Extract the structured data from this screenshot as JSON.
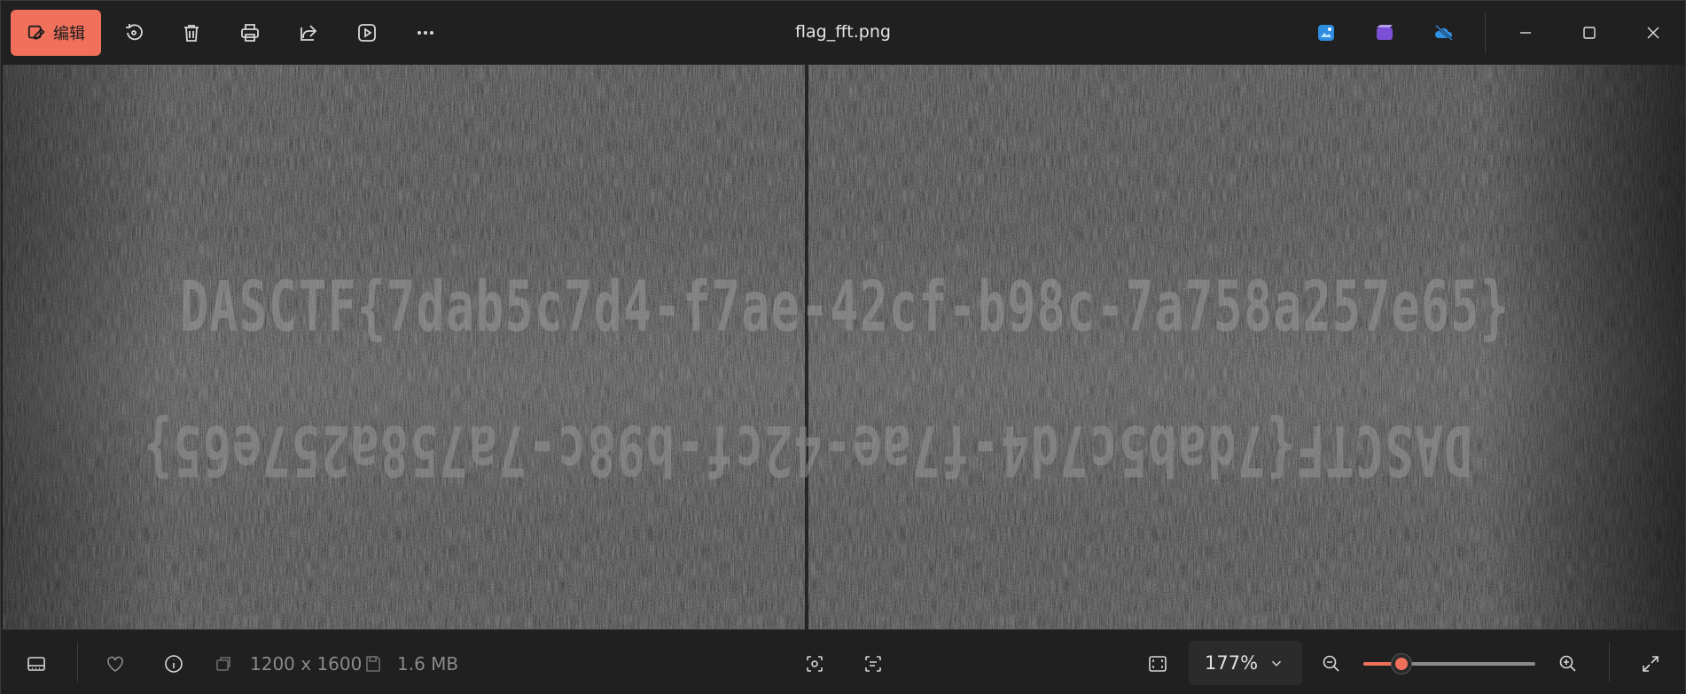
{
  "toolbar": {
    "edit_label": "编辑",
    "icons": [
      "rotate-icon",
      "delete-icon",
      "print-icon",
      "share-icon",
      "slideshow-icon",
      "more-icon"
    ]
  },
  "window": {
    "title": "flag_fft.png",
    "app_icons": [
      "photo-editor-icon",
      "clipchamp-icon",
      "onedrive-offline-icon"
    ],
    "controls": [
      "minimize-icon",
      "maximize-icon",
      "close-icon"
    ]
  },
  "image": {
    "line1": "DASCTF{7dab5c7d4-f7ae-42cf-b98c-7a758a257e65}",
    "line2": "DASCTF{7dab5c7d4-f7ae-42cf-b98c-7a758a257e65}"
  },
  "statusbar": {
    "dimensions": "1200 x 1600",
    "file_size": "1.6 MB",
    "zoom_value": "177%",
    "zoom_fraction": 0.22
  },
  "colors": {
    "accent": "#f0705c",
    "background": "#202020",
    "viewport": "#151515"
  }
}
